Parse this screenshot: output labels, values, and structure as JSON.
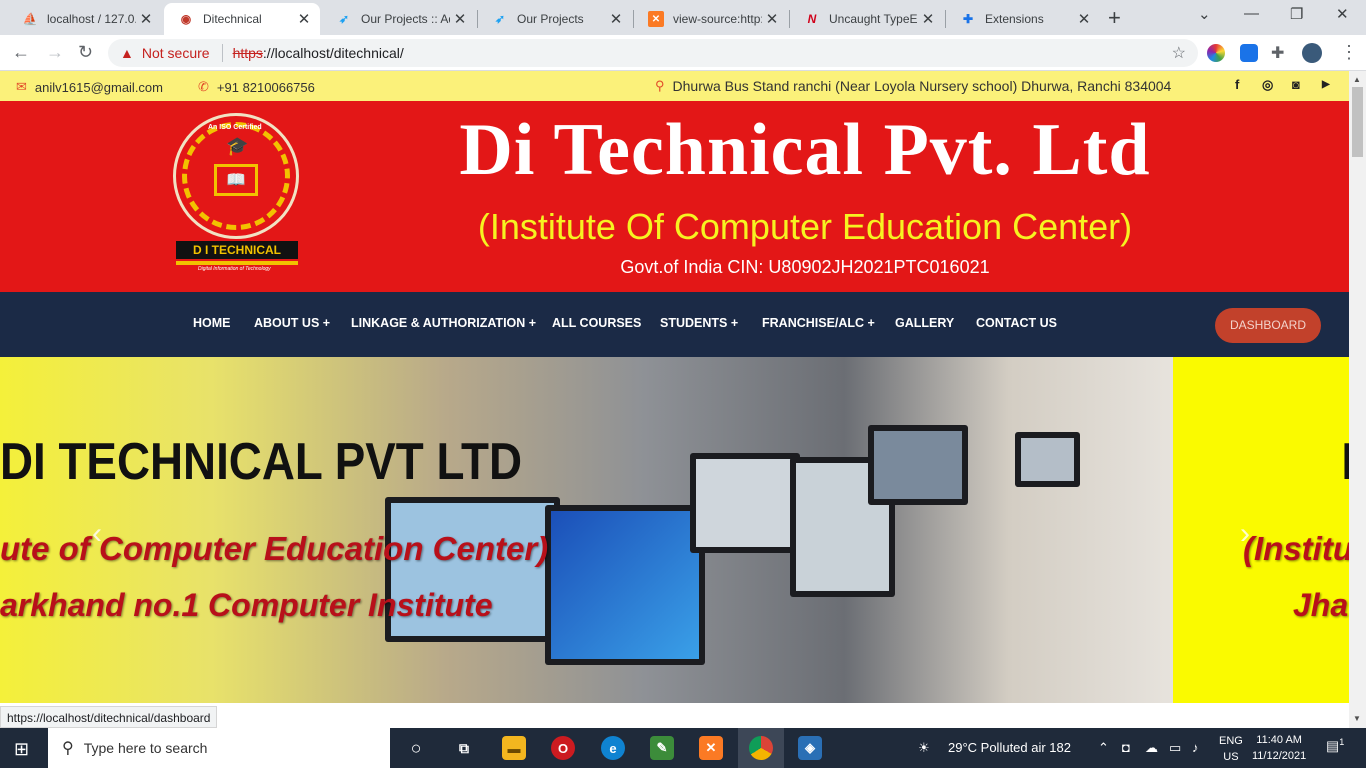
{
  "browser": {
    "tabs": [
      {
        "title": "localhost / 127.0.0",
        "icon": "phpmyadmin-icon"
      },
      {
        "title": "Ditechnical",
        "icon": "site-logo-icon",
        "active": true
      },
      {
        "title": "Our Projects :: Adm",
        "icon": "twitter-bird-icon"
      },
      {
        "title": "Our Projects",
        "icon": "twitter-bird-icon"
      },
      {
        "title": "view-source:http://",
        "icon": "xampp-icon"
      },
      {
        "title": "Uncaught TypeErr",
        "icon": "n-icon"
      },
      {
        "title": "Extensions",
        "icon": "puzzle-icon"
      }
    ],
    "security_label": "Not secure",
    "url_scheme": "https",
    "url_rest": "://localhost/ditechnical/",
    "status_url": "https://localhost/ditechnical/dashboard"
  },
  "topbar": {
    "email": "anilv1615@gmail.com",
    "phone": "+91 8210066756",
    "address": "Dhurwa Bus Stand ranchi (Near Loyola Nursery school) Dhurwa, Ranchi 834004",
    "social": [
      "facebook-icon",
      "whatsapp-icon",
      "instagram-icon",
      "youtube-icon"
    ]
  },
  "header": {
    "logo_top": "An ISO Certified",
    "logo_band": "D I TECHNICAL",
    "logo_tag": "Digital Information of Technology",
    "company_name": "Di Technical Pvt. Ltd",
    "subtitle": "(Institute Of Computer Education Center)",
    "cin": "Govt.of India CIN: U80902JH2021PTC016021"
  },
  "nav": {
    "items": [
      "HOME",
      "ABOUT US +",
      "LINKAGE & AUTHORIZATION +",
      "ALL COURSES",
      "STUDENTS +",
      "FRANCHISE/ALC +",
      "GALLERY",
      "CONTACT US"
    ],
    "dashboard": "DASHBOARD"
  },
  "slider": {
    "title": "DI TECHNICAL PVT LTD",
    "line1": "ute of Computer Education Center)",
    "line2": "arkhand no.1 Computer Institute",
    "next_title": "I",
    "next_line1": "(Institu",
    "next_line2": "Jha",
    "prev": "‹",
    "next": "›"
  },
  "taskbar": {
    "search_placeholder": "Type here to search",
    "weather": "29°C  Polluted air 182",
    "lang1": "ENG",
    "lang2": "US",
    "time": "11:40 AM",
    "date": "11/12/2021",
    "notifications": "1"
  },
  "colors": {
    "banner_red": "#e31717",
    "topbar_yellow": "#fbf17a",
    "nav_dark": "#1b2a46",
    "dashboard_btn": "#c2412b",
    "subtitle_yellow": "#f6f321"
  }
}
